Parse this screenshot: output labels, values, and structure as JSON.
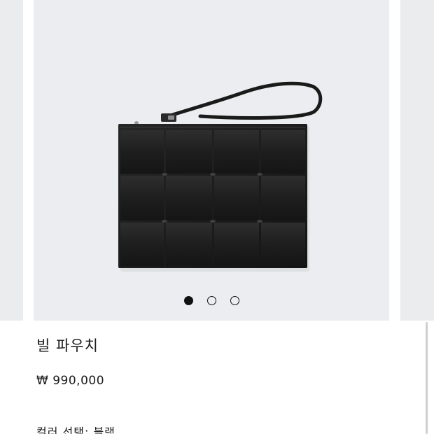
{
  "product": {
    "title": "빌 파우치",
    "price": "₩ 990,000",
    "color_select_label": "컬러 선택: 블랙"
  },
  "carousel": {
    "image_alt": "black-intrecciato-leather-pouch",
    "total_slides": 3,
    "active_slide": 1
  },
  "colors": {
    "slide_background": "#ecedf0",
    "leather": "#1c1c1c",
    "text": "#1a1a1a",
    "active_dot": "#111111"
  }
}
